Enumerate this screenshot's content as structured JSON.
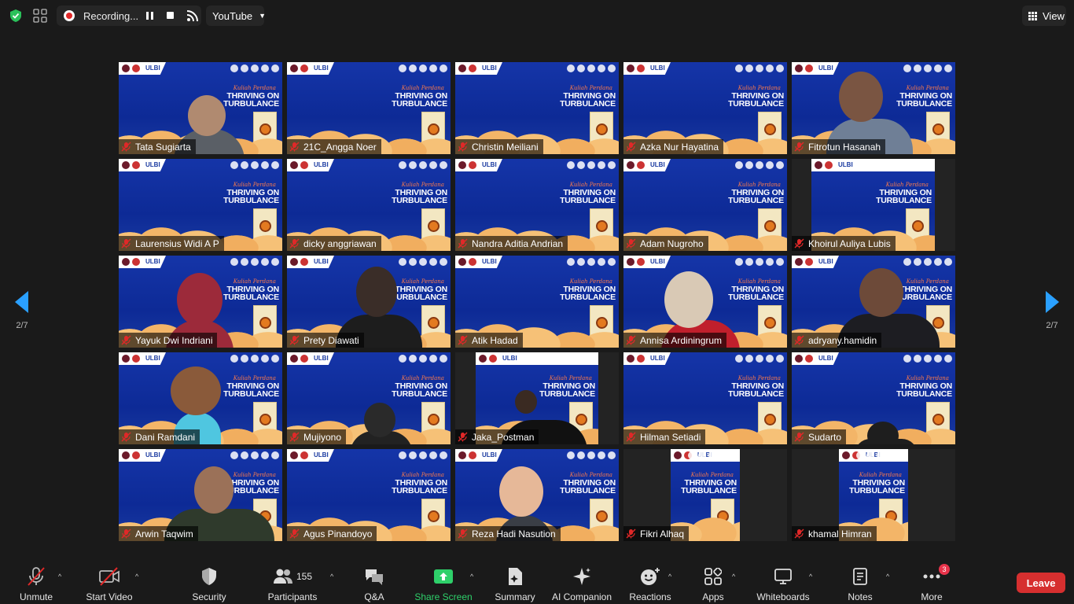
{
  "topbar": {
    "recording_label": "Recording...",
    "stream_label": "YouTube",
    "view_label": "View",
    "shield_icon": "shield-check-icon",
    "grid_icon": "apps-grid-icon"
  },
  "pagination": {
    "left": "2/7",
    "right": "2/7"
  },
  "participants": [
    {
      "name": "Tata Sugiarta"
    },
    {
      "name": "21C_Angga Noer"
    },
    {
      "name": "Christin Meiliani"
    },
    {
      "name": "Azka Nur Hayatina"
    },
    {
      "name": "Fitrotun Hasanah"
    },
    {
      "name": "Laurensius Widi A P"
    },
    {
      "name": "dicky anggriawan"
    },
    {
      "name": "Nandra Aditia Andrian"
    },
    {
      "name": "Adam Nugroho"
    },
    {
      "name": "Khoirul Auliya Lubis"
    },
    {
      "name": "Yayuk Dwi Indriani"
    },
    {
      "name": "Prety Diawati"
    },
    {
      "name": "Atik Hadad"
    },
    {
      "name": "Annisa Ardiningrum"
    },
    {
      "name": "adryany.hamidin"
    },
    {
      "name": "Dani Ramdani"
    },
    {
      "name": "Mujiyono"
    },
    {
      "name": "Jaka_Postman"
    },
    {
      "name": "Hilman Setiadi"
    },
    {
      "name": "Sudarto"
    },
    {
      "name": "Arwin Taqwim"
    },
    {
      "name": "Agus Pinandoyo"
    },
    {
      "name": "Reza Hadi Nasution"
    },
    {
      "name": "Fikri Alhaq"
    },
    {
      "name": "khamal Himran"
    }
  ],
  "slide": {
    "ulbi": "ULBI",
    "kuliah": "Kuliah Perdana",
    "title_line1": "THRIVING ON",
    "title_line2": "TURBULANCE"
  },
  "toolbar": {
    "unmute": "Unmute",
    "start_video": "Start Video",
    "security": "Security",
    "participants": "Participants",
    "participants_count": "155",
    "qa": "Q&A",
    "share_screen": "Share Screen",
    "summary": "Summary",
    "ai_companion": "AI Companion",
    "reactions": "Reactions",
    "apps": "Apps",
    "whiteboards": "Whiteboards",
    "notes": "Notes",
    "more": "More",
    "more_badge": "3",
    "leave": "Leave"
  },
  "colors": {
    "background": "#1a1a1a",
    "accent_green": "#2ed06a",
    "leave_red": "#d62f2f",
    "mic_off_red": "#e02828"
  }
}
